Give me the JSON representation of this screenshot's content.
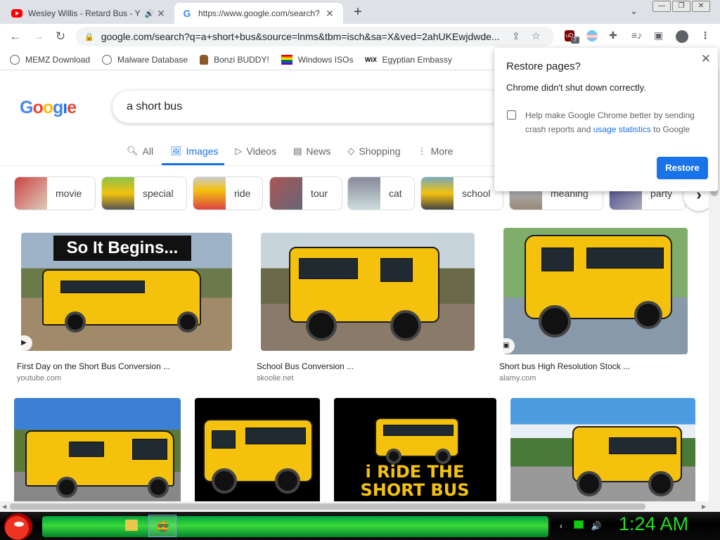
{
  "browser": {
    "tabs": [
      {
        "title": "Wesley Willis - Retard Bus - Y",
        "icon": "youtube-icon",
        "audio": true
      },
      {
        "title": "https://www.google.com/search?",
        "icon": "google-icon",
        "active": true
      }
    ],
    "new_tab_label": "+",
    "url": "google.com/search?q=a+short+bus&source=lnms&tbm=isch&sa=X&ved=2ahUKEwjdwde...",
    "extension_badge": "7",
    "bookmarks": [
      {
        "label": "MEMZ Download",
        "icon": "globe-icon"
      },
      {
        "label": "Malware Database",
        "icon": "globe-icon"
      },
      {
        "label": "Bonzi BUDDY!",
        "icon": "bonzi-icon"
      },
      {
        "label": "Windows ISOs",
        "icon": "rainbow-flag-icon"
      },
      {
        "label": "Egyptian Embassy",
        "icon": "wix-icon"
      }
    ]
  },
  "google": {
    "query": "a short bus",
    "vertical_tabs": [
      "All",
      "Images",
      "Videos",
      "News",
      "Shopping",
      "More"
    ],
    "active_tab": "Images",
    "chips": [
      "movie",
      "special",
      "ride",
      "tour",
      "cat",
      "school",
      "meaning",
      "party"
    ],
    "results": [
      {
        "caption": "First Day on the Short Bus Conversion ...",
        "site": "youtube.com",
        "overlay": "So It Begins..."
      },
      {
        "caption": "School Bus Conversion ...",
        "site": "skoolie.net"
      },
      {
        "caption": "Short bus High Resolution Stock ...",
        "site": "alamy.com"
      },
      {
        "caption": "",
        "site": ""
      },
      {
        "caption": "",
        "site": ""
      },
      {
        "caption": "",
        "site": "",
        "overlay": "i RiDE THE SHORT BUS"
      },
      {
        "caption": "",
        "site": ""
      }
    ]
  },
  "popup": {
    "title": "Restore pages?",
    "message": "Chrome didn't shut down correctly.",
    "help_text": "Help make Google Chrome better by sending crash reports and",
    "help_link": "usage statistics",
    "help_suffix": "to Google",
    "button": "Restore"
  },
  "taskbar": {
    "clock": "1:24 AM"
  },
  "colors": {
    "accent": "#1a73e8",
    "bus_yellow": "#f4c20d",
    "clock_green": "#22dd22"
  }
}
